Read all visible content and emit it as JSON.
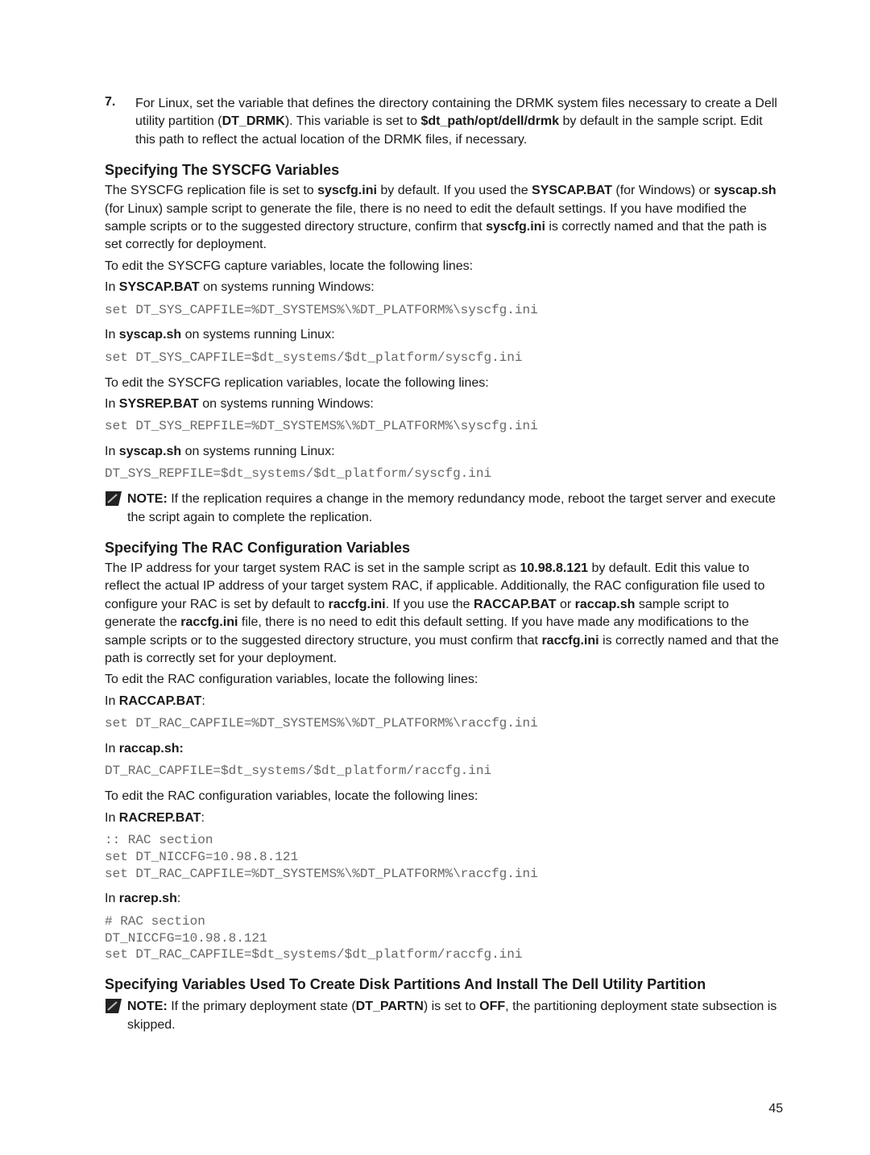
{
  "item7": {
    "num": "7.",
    "text_a": "For Linux, set the variable that defines the directory containing the DRMK system files necessary to create a Dell utility partition (",
    "dt_drmk": "DT_DRMK",
    "text_b": "). This variable is set to ",
    "path": "$dt_path/opt/dell/drmk",
    "text_c": " by default in the sample script. Edit this path to reflect the actual location of the DRMK files, if necessary."
  },
  "syscfg": {
    "heading": "Specifying The SYSCFG Variables",
    "p1_a": "The SYSCFG replication file is set to ",
    "p1_file": "syscfg.ini",
    "p1_b": " by default. If you used the ",
    "p1_bat": "SYSCAP.BAT",
    "p1_c": " (for Windows) or ",
    "p1_sh": "syscap.sh",
    "p1_d": " (for Linux) sample script to generate the file, there is no need to edit the default settings. If you have modified the sample scripts or to the suggested directory structure, confirm that ",
    "p1_file2": "syscfg.ini",
    "p1_e": " is correctly named and that the path is set correctly for deployment.",
    "p2": "To edit the SYSCFG capture variables, locate the following lines:",
    "p3_a": "In ",
    "p3_b": "SYSCAP.BAT",
    "p3_c": " on systems running Windows:",
    "code1": "set DT_SYS_CAPFILE=%DT_SYSTEMS%\\%DT_PLATFORM%\\syscfg.ini",
    "p4_a": "In ",
    "p4_b": "syscap.sh",
    "p4_c": " on systems running Linux:",
    "code2": "set DT_SYS_CAPFILE=$dt_systems/$dt_platform/syscfg.ini",
    "p5": "To edit the SYSCFG replication variables, locate the following lines:",
    "p6_a": "In ",
    "p6_b": "SYSREP.BAT",
    "p6_c": " on systems running Windows:",
    "code3": "set DT_SYS_REPFILE=%DT_SYSTEMS%\\%DT_PLATFORM%\\syscfg.ini",
    "p7_a": "In ",
    "p7_b": "syscap.sh",
    "p7_c": " on systems running Linux:",
    "code4": "DT_SYS_REPFILE=$dt_systems/$dt_platform/syscfg.ini",
    "note_label": "NOTE: ",
    "note_text": "If the replication requires a change in the memory redundancy mode, reboot the target server and execute the script again to complete the replication."
  },
  "rac": {
    "heading": "Specifying The RAC Configuration Variables",
    "p1_a": "The IP address for your target system RAC is set in the sample script as ",
    "p1_ip": "10.98.8.121",
    "p1_b": " by default. Edit this value to reflect the actual IP address of your target system RAC, if applicable. Additionally, the RAC configuration file used to configure your RAC is set by default to ",
    "p1_f1": "raccfg.ini",
    "p1_c": ". If you use the ",
    "p1_bat": "RACCAP.BAT",
    "p1_d": " or ",
    "p1_sh": "raccap.sh",
    "p1_e": " sample script to generate the ",
    "p1_f2": "raccfg.ini",
    "p1_f": " file, there is no need to edit this default setting. If you have made any modifications to the sample scripts or to the suggested directory structure, you must confirm that ",
    "p1_f3": "raccfg.ini",
    "p1_g": " is correctly named and that the path is correctly set for your deployment.",
    "p2": "To edit the RAC configuration variables, locate the following lines:",
    "p3_a": "In ",
    "p3_b": "RACCAP.BAT",
    "p3_c": ":",
    "code1": "set DT_RAC_CAPFILE=%DT_SYSTEMS%\\%DT_PLATFORM%\\raccfg.ini",
    "p4_a": "In ",
    "p4_b": "raccap.sh:",
    "code2": "DT_RAC_CAPFILE=$dt_systems/$dt_platform/raccfg.ini",
    "p5": "To edit the RAC configuration variables, locate the following lines:",
    "p6_a": "In ",
    "p6_b": "RACREP.BAT",
    "p6_c": ":",
    "code3": ":: RAC section\nset DT_NICCFG=10.98.8.121\nset DT_RAC_CAPFILE=%DT_SYSTEMS%\\%DT_PLATFORM%\\raccfg.ini",
    "p7_a": "In ",
    "p7_b": "racrep.sh",
    "p7_c": ":",
    "code4": "# RAC section\nDT_NICCFG=10.98.8.121\nset DT_RAC_CAPFILE=$dt_systems/$dt_platform/raccfg.ini"
  },
  "disk": {
    "heading": "Specifying Variables Used To Create Disk Partitions And Install The Dell Utility Partition",
    "note_label": "NOTE: ",
    "note_a": "If the primary deployment state (",
    "dt_partn": "DT_PARTN",
    "note_b": ") is set to ",
    "off": "OFF",
    "note_c": ", the partitioning deployment state subsection is skipped."
  },
  "page_number": "45"
}
